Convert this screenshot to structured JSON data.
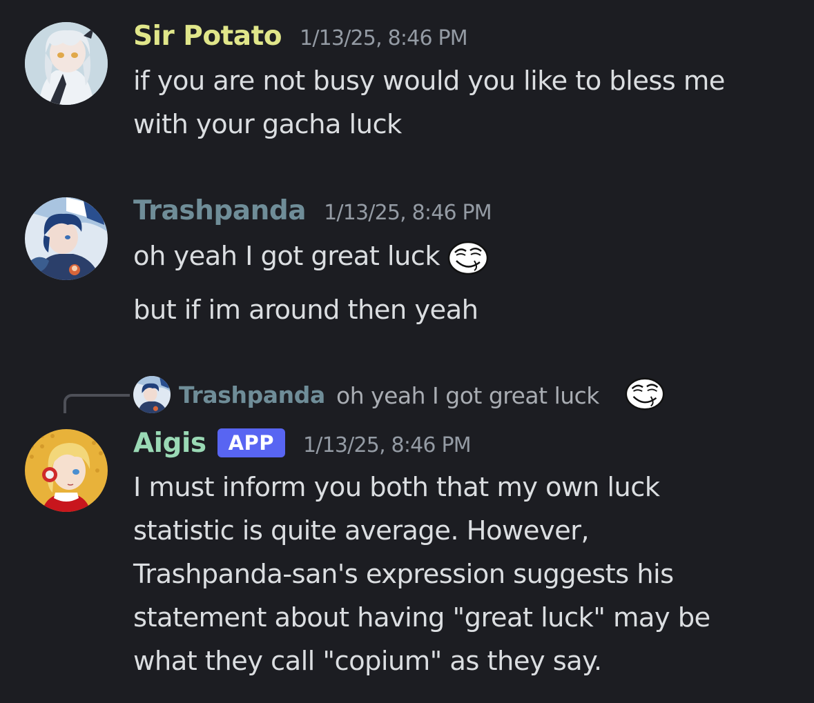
{
  "messages": [
    {
      "username": "Sir Potato",
      "username_color": "#e0e68a",
      "timestamp": "1/13/25, 8:46 PM",
      "avatar_icon": "anime-girl-avatar",
      "lines": [
        "if you are not busy would you like to bless me",
        "with your gacha luck"
      ]
    },
    {
      "username": "Trashpanda",
      "username_color": "#6f8d98",
      "timestamp": "1/13/25, 8:46 PM",
      "avatar_icon": "anime-boy-blue-hair-avatar",
      "lines": [
        "oh yeah I got great luck",
        "but if im around then yeah"
      ],
      "emoji": "smug-face-emoji"
    },
    {
      "username": "Aigis",
      "username_color": "#9ad9b5",
      "badge": "APP",
      "badge_color": "#5865f2",
      "timestamp": "1/13/25, 8:46 PM",
      "avatar_icon": "blonde-android-avatar",
      "reply": {
        "username": "Trashpanda",
        "text": "oh yeah I got great luck",
        "emoji": "smug-face-emoji"
      },
      "lines": [
        "I must inform you both that my own luck",
        "statistic is quite average. However,",
        "Trashpanda-san's expression suggests his",
        "statement about having \"great luck\" may be",
        "what they call \"copium\" as they say."
      ]
    }
  ],
  "colors": {
    "background": "#1c1d22",
    "text": "#dbdee1",
    "timestamp": "#949ba4"
  }
}
